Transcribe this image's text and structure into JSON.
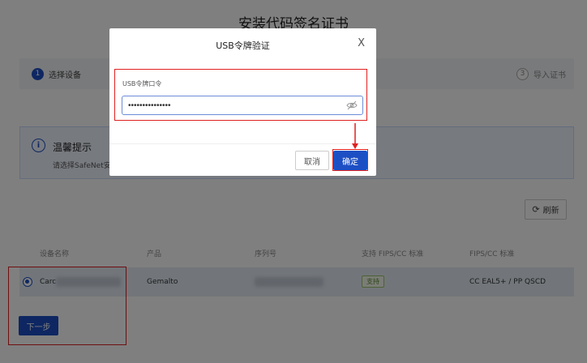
{
  "page": {
    "title": "安装代码签名证书"
  },
  "steps": [
    {
      "num": "1",
      "label": "选择设备"
    },
    {
      "num": "3",
      "label": "导入证书"
    }
  ],
  "tip": {
    "icon": "info-icon",
    "title": "温馨提示",
    "text": "请选择SafeNet安全"
  },
  "refresh": {
    "icon": "refresh-icon",
    "label": "刷新"
  },
  "table": {
    "headers": [
      "设备名称",
      "产品",
      "序列号",
      "支持 FIPS/CC 标准",
      "FIPS/CC 标准"
    ],
    "row": {
      "device_name": "Carc",
      "product": "Gemalto",
      "support": "支持",
      "standard": "CC EAL5+ / PP QSCD"
    }
  },
  "next_button": "下一步",
  "modal": {
    "title": "USB令牌验证",
    "close": "X",
    "field_label": "USB令牌口令",
    "field_value": "•••••••••••••••",
    "cancel": "取消",
    "confirm": "确定"
  },
  "colors": {
    "primary": "#1d4fc4",
    "annotation": "#e02020"
  }
}
